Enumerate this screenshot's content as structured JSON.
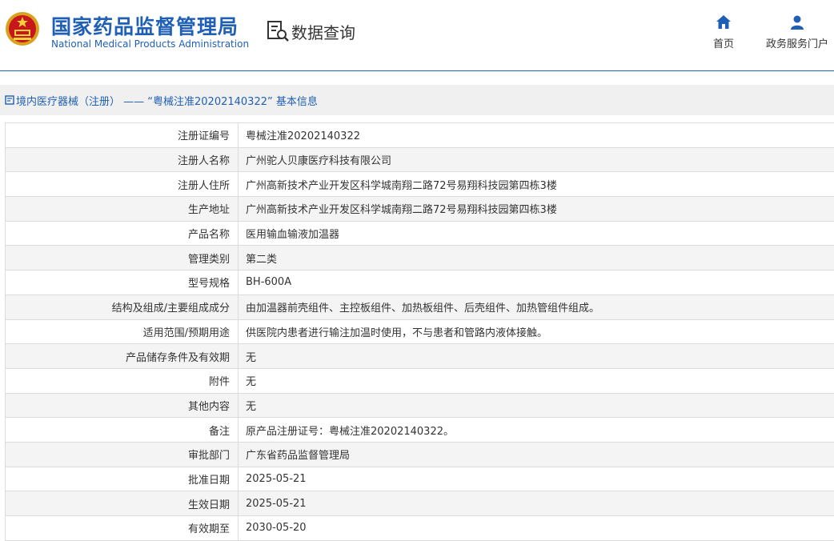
{
  "header": {
    "org_name_cn": "国家药品监督管理局",
    "org_name_en": "National Medical Products Administration",
    "query_label": "数据查询",
    "nav": {
      "home": "首页",
      "portal": "政务服务门户"
    },
    "brand_color": "#1f5fb5"
  },
  "breadcrumb": "境内医疗器械（注册） —— “粤械注准20202140322” 基本信息",
  "rows": [
    {
      "label": "注册证编号",
      "value": "粤械注准20202140322"
    },
    {
      "label": "注册人名称",
      "value": "广州驼人贝康医疗科技有限公司"
    },
    {
      "label": "注册人住所",
      "value": "广州高新技术产业开发区科学城南翔二路72号易翔科技园第四栋3楼"
    },
    {
      "label": "生产地址",
      "value": "广州高新技术产业开发区科学城南翔二路72号易翔科技园第四栋3楼"
    },
    {
      "label": "产品名称",
      "value": "医用输血输液加温器"
    },
    {
      "label": "管理类别",
      "value": "第二类"
    },
    {
      "label": "型号规格",
      "value": "BH-600A"
    },
    {
      "label": "结构及组成/主要组成成分",
      "value": "由加温器前壳组件、主控板组件、加热板组件、后壳组件、加热管组件组成。"
    },
    {
      "label": "适用范围/预期用途",
      "value": "供医院内患者进行输注加温时使用，不与患者和管路内液体接触。"
    },
    {
      "label": "产品储存条件及有效期",
      "value": "无"
    },
    {
      "label": "附件",
      "value": "无"
    },
    {
      "label": "其他内容",
      "value": "无"
    },
    {
      "label": "备注",
      "value": "原产品注册证号：粤械注准20202140322。"
    },
    {
      "label": "审批部门",
      "value": "广东省药品监督管理局"
    },
    {
      "label": "批准日期",
      "value": "2025-05-21"
    },
    {
      "label": "生效日期",
      "value": "2025-05-21"
    },
    {
      "label": "有效期至",
      "value": "2030-05-20"
    }
  ]
}
